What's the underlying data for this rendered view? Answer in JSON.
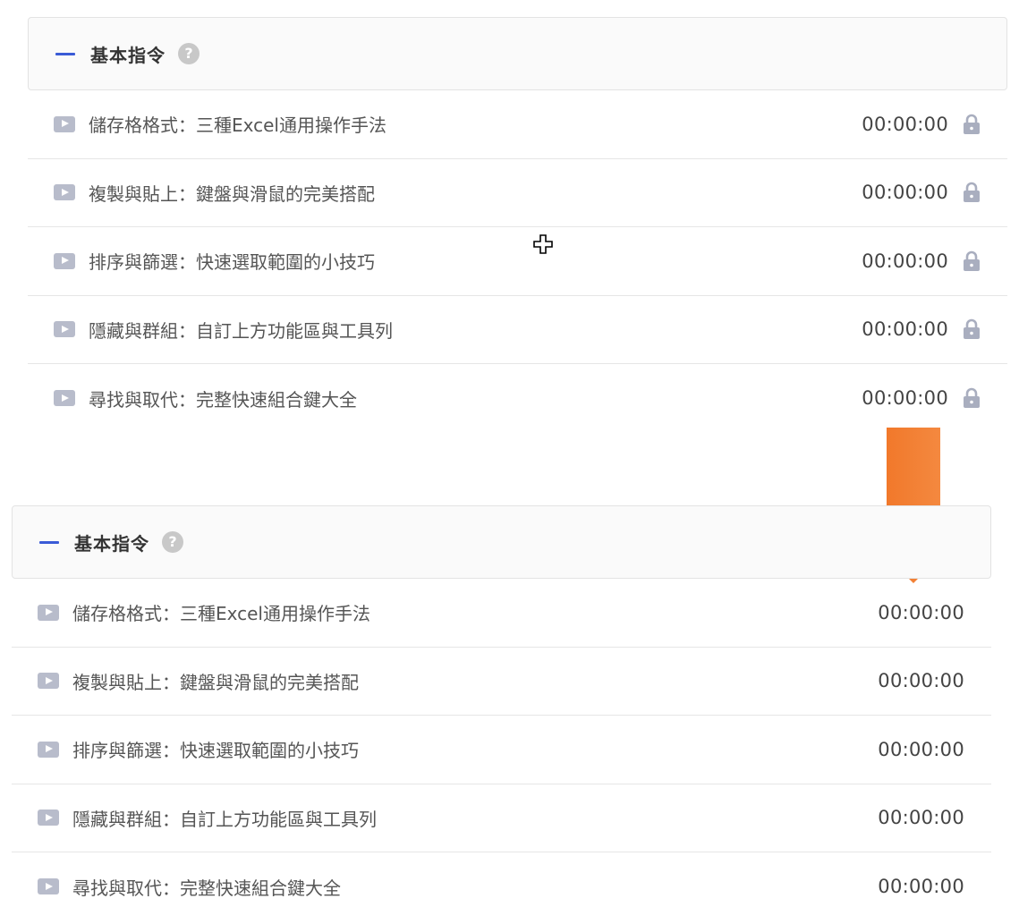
{
  "sections": [
    {
      "title": "基本指令",
      "help_glyph": "?",
      "lessons": [
        {
          "title": "儲存格格式：三種Excel通用操作手法",
          "duration": "00:00:00"
        },
        {
          "title": "複製與貼上：鍵盤與滑鼠的完美搭配",
          "duration": "00:00:00"
        },
        {
          "title": "排序與篩選：快速選取範圍的小技巧",
          "duration": "00:00:00"
        },
        {
          "title": "隱藏與群組：自訂上方功能區與工具列",
          "duration": "00:00:00"
        },
        {
          "title": "尋找與取代：完整快速組合鍵大全",
          "duration": "00:00:00"
        }
      ]
    },
    {
      "title": "基本指令",
      "help_glyph": "?",
      "lessons": [
        {
          "title": "儲存格格式：三種Excel通用操作手法",
          "duration": "00:00:00"
        },
        {
          "title": "複製與貼上：鍵盤與滑鼠的完美搭配",
          "duration": "00:00:00"
        },
        {
          "title": "排序與篩選：快速選取範圍的小技巧",
          "duration": "00:00:00"
        },
        {
          "title": "隱藏與群組：自訂上方功能區與工具列",
          "duration": "00:00:00"
        },
        {
          "title": "尋找與取代：完整快速組合鍵大全",
          "duration": "00:00:00"
        }
      ]
    }
  ],
  "icons": {
    "collapse": "minus-icon",
    "help": "question-circle-icon",
    "play": "play-video-icon",
    "lock": "lock-icon",
    "cursor": "crosshair-cursor-icon",
    "annotation": "down-arrow-icon"
  },
  "colors": {
    "accent": "#3a5bd6",
    "play_icon": "#b8bccb",
    "lock_icon": "#a9aebf",
    "arrow_start": "#f07020",
    "arrow_end": "#f5914a"
  }
}
